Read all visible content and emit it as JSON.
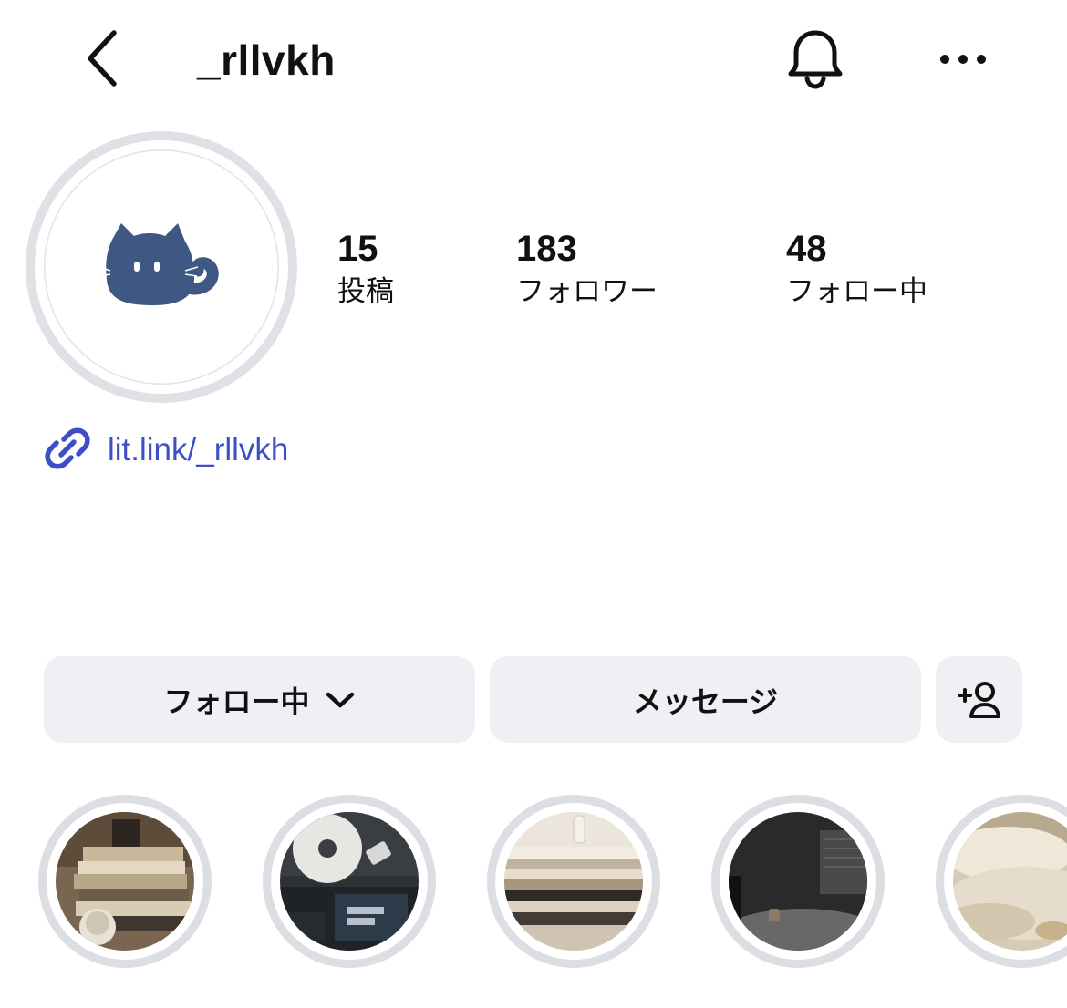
{
  "header": {
    "username": "_rllvkh",
    "icons": {
      "back": "chevron-left-icon",
      "notifications": "bell-icon",
      "more": "more-horizontal-icon"
    }
  },
  "avatar": {
    "image": "navy-cat-illustration"
  },
  "stats": [
    {
      "value": "15",
      "label": "投稿"
    },
    {
      "value": "183",
      "label": "フォロワー"
    },
    {
      "value": "48",
      "label": "フォロー中"
    }
  ],
  "bio": {
    "link_text": "lit.link/_rllvkh",
    "link_icon": "link-icon"
  },
  "actions": {
    "following_label": "フォロー中",
    "message_label": "メッセージ",
    "add_person_icon": "add-person-icon"
  },
  "highlights": [
    {
      "image": "stacked-books-candle"
    },
    {
      "image": "vinyl-record-player"
    },
    {
      "image": "stacked-books-glass"
    },
    {
      "image": "dark-room-table"
    },
    {
      "image": "cream-blanket"
    }
  ],
  "colors": {
    "link": "#3d4fc7",
    "button_bg": "#eff0f4",
    "ring": "#dcdee4",
    "avatar_cat": "#3f5783"
  }
}
